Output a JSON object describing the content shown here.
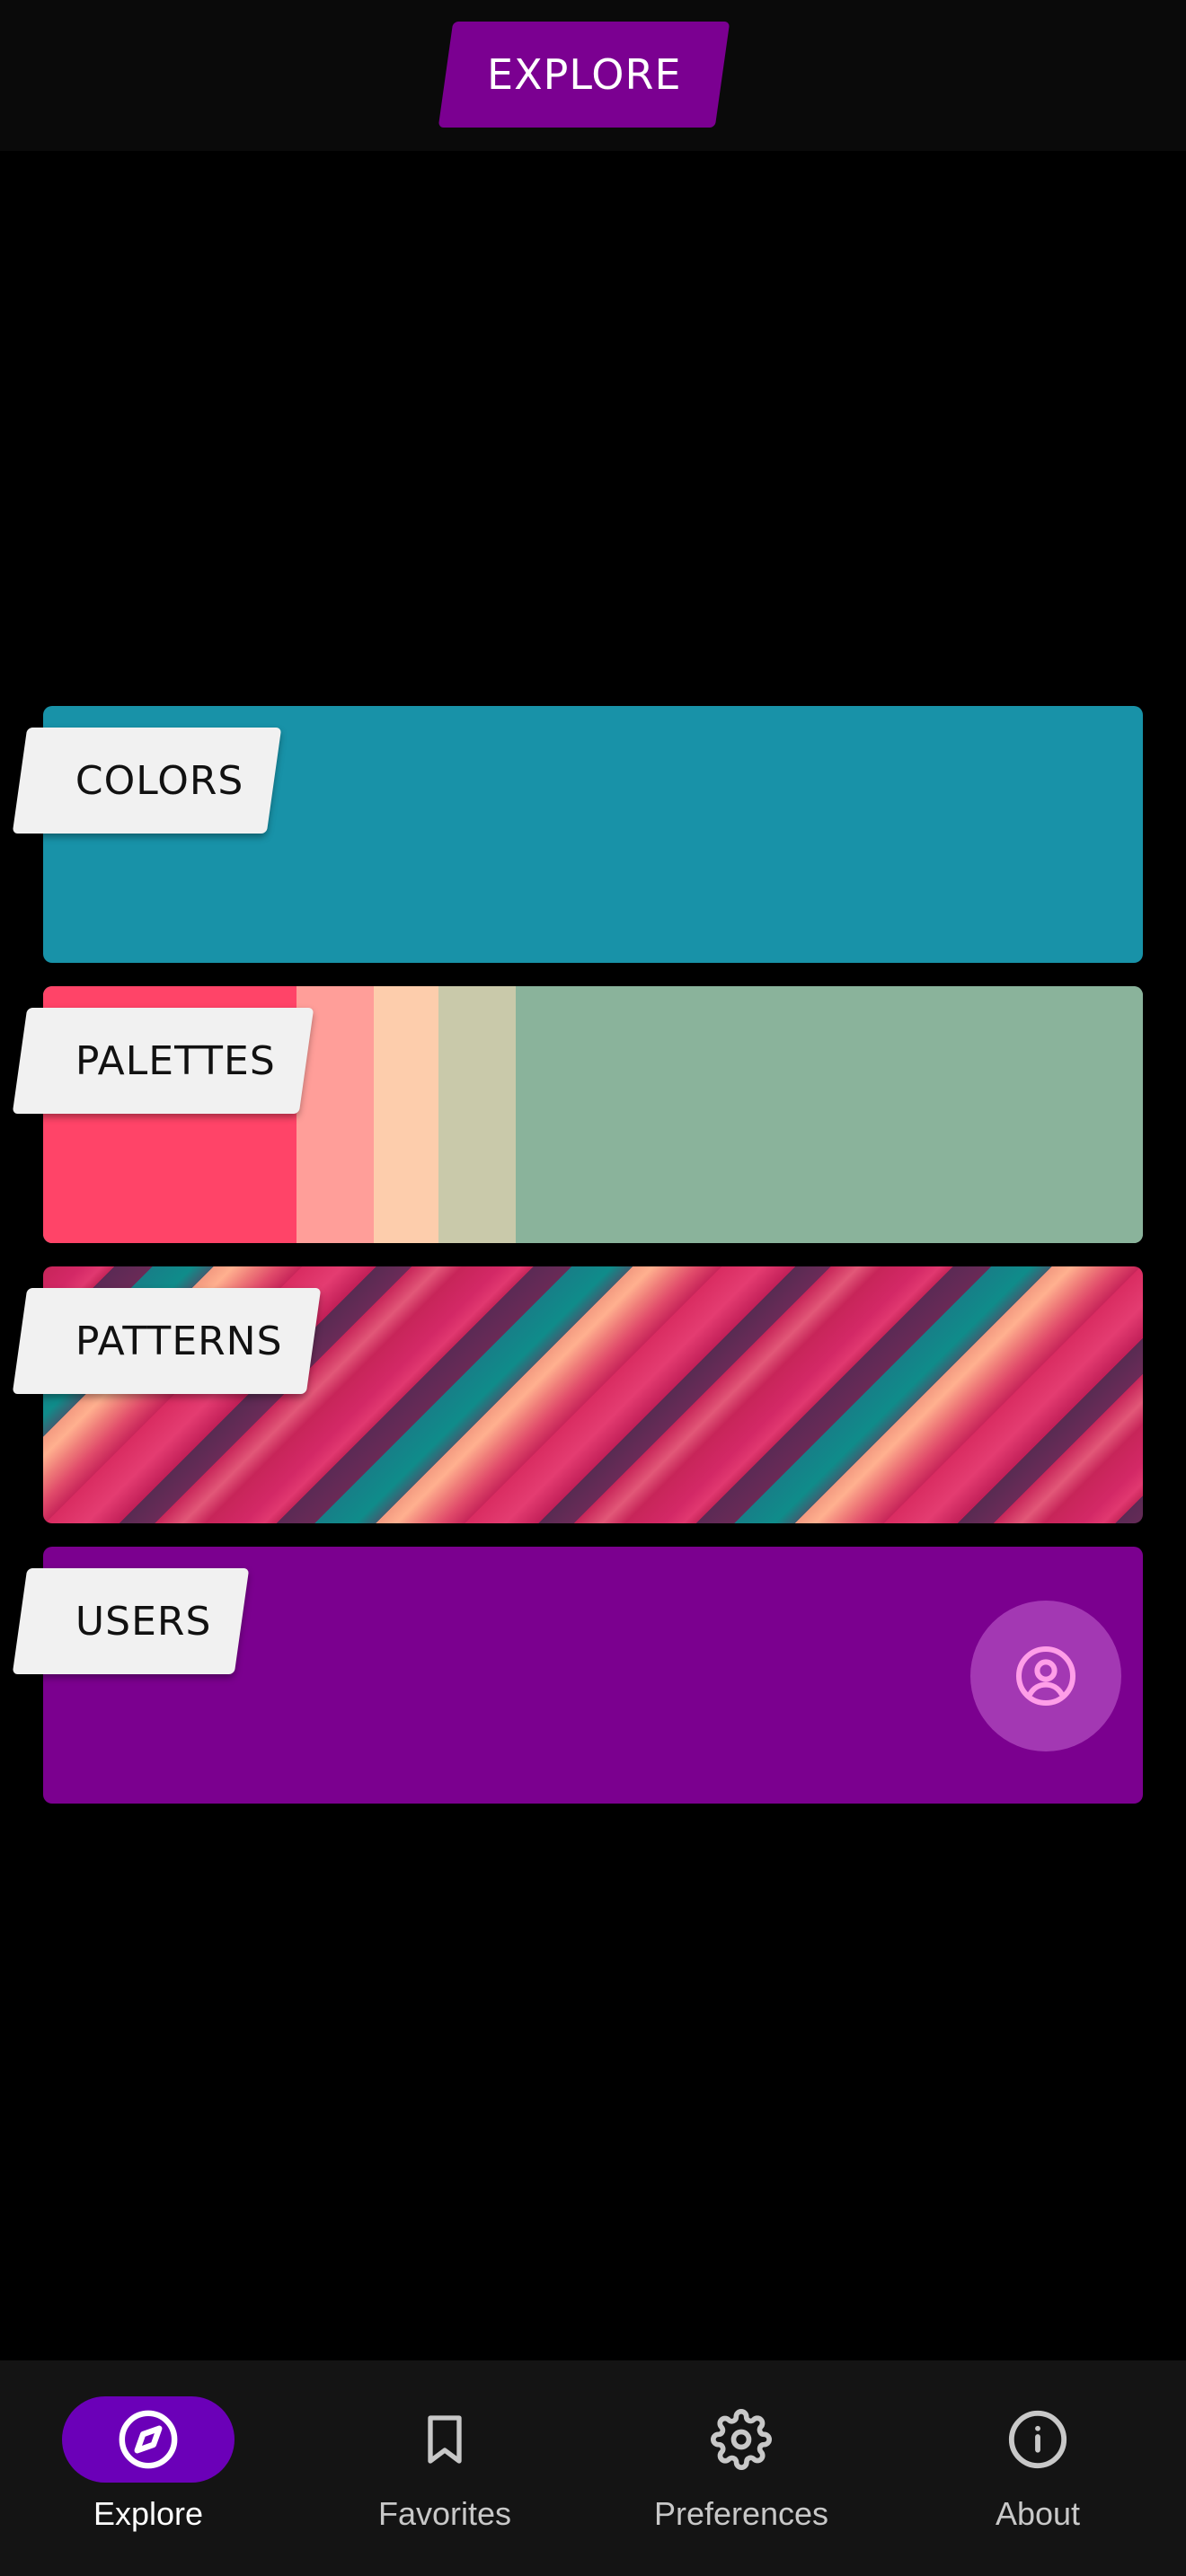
{
  "header": {
    "title": "EXPLORE"
  },
  "cards": [
    {
      "label": "COLORS",
      "color": "#1892a8"
    },
    {
      "label": "PALETTES",
      "swatches": [
        "#ff4468",
        "#ff9e99",
        "#fdcdac",
        "#c9c9aa",
        "#8ab39b"
      ]
    },
    {
      "label": "PATTERNS"
    },
    {
      "label": "USERS",
      "color": "#7b008f",
      "icon": "user-circle-icon"
    }
  ],
  "nav": {
    "items": [
      {
        "label": "Explore",
        "icon": "compass-icon",
        "active": true
      },
      {
        "label": "Favorites",
        "icon": "bookmark-icon",
        "active": false
      },
      {
        "label": "Preferences",
        "icon": "gear-icon",
        "active": false
      },
      {
        "label": "About",
        "icon": "info-icon",
        "active": false
      }
    ]
  },
  "colors": {
    "accent": "#7b0091",
    "nav_active": "#6b00b8"
  }
}
